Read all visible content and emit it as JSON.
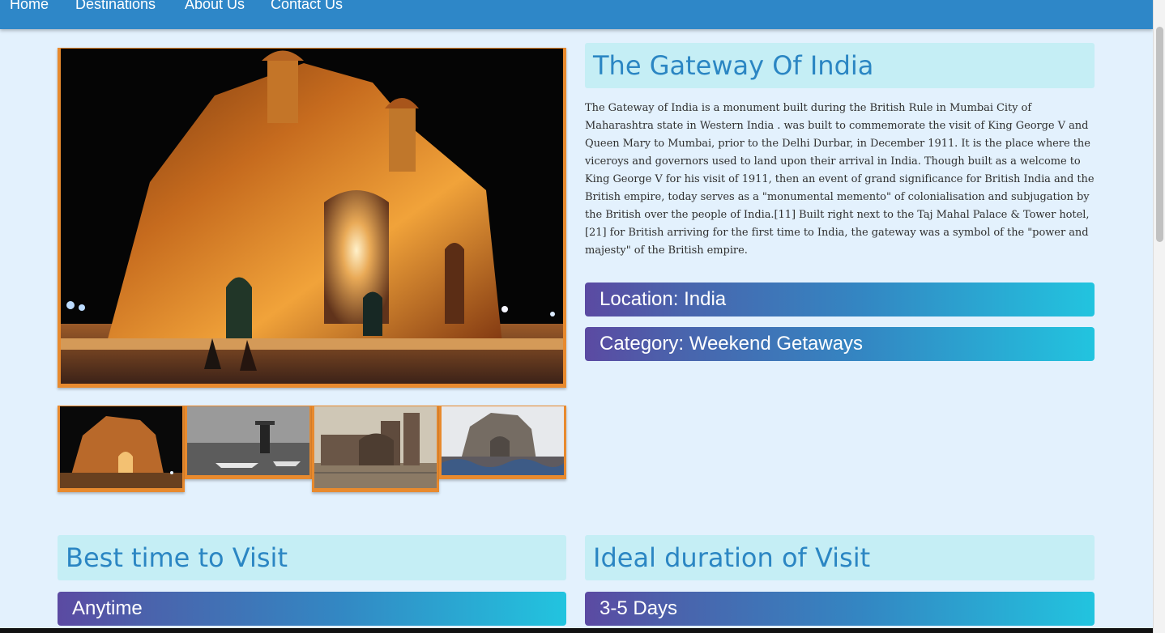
{
  "nav": {
    "items": [
      {
        "label": "Home"
      },
      {
        "label": "Destinations"
      },
      {
        "label": "About Us"
      },
      {
        "label": "Contact Us"
      }
    ]
  },
  "destination": {
    "title": "The Gateway Of India",
    "description": "The Gateway of India is a monument built during the British Rule in Mumbai City of Maharashtra state in Western India . was built to commemorate the visit of King George V and Queen Mary to Mumbai, prior to the Delhi Durbar, in December 1911. It is the place where the viceroys and governors used to land upon their arrival in India. Though built as a welcome to King George V for his visit of 1911, then an event of grand significance for British India and the British empire, today serves as a \"monumental memento\" of colonialisation and subjugation by the British over the people of India.[11] Built right next to the Taj Mahal Palace & Tower hotel,[21] for British arriving for the first time to India, the gateway was a symbol of the \"power and majesty\" of the British empire.",
    "location": "Location: India",
    "category": "Category: Weekend Getaways"
  },
  "visit": {
    "best_time_heading": "Best time to Visit",
    "best_time_value": "Anytime",
    "ideal_duration_heading": "Ideal duration of Visit",
    "ideal_duration_value": "3-5 Days"
  },
  "colors": {
    "navbar": "#2e87c8",
    "page_background": "#e3f1fd",
    "heading_background": "#c5eef5",
    "heading_text": "#2b86c3",
    "image_border": "#e88a2e",
    "gradient_start": "#5b4aa2",
    "gradient_end": "#22c4df"
  },
  "icons": {
    "main_photo": "gateway-night-photo",
    "thumb_1": "gateway-night-thumb",
    "thumb_2": "sea-lighthouse-thumb",
    "thumb_3": "taj-hotel-thumb",
    "thumb_4": "gateway-day-thumb"
  }
}
